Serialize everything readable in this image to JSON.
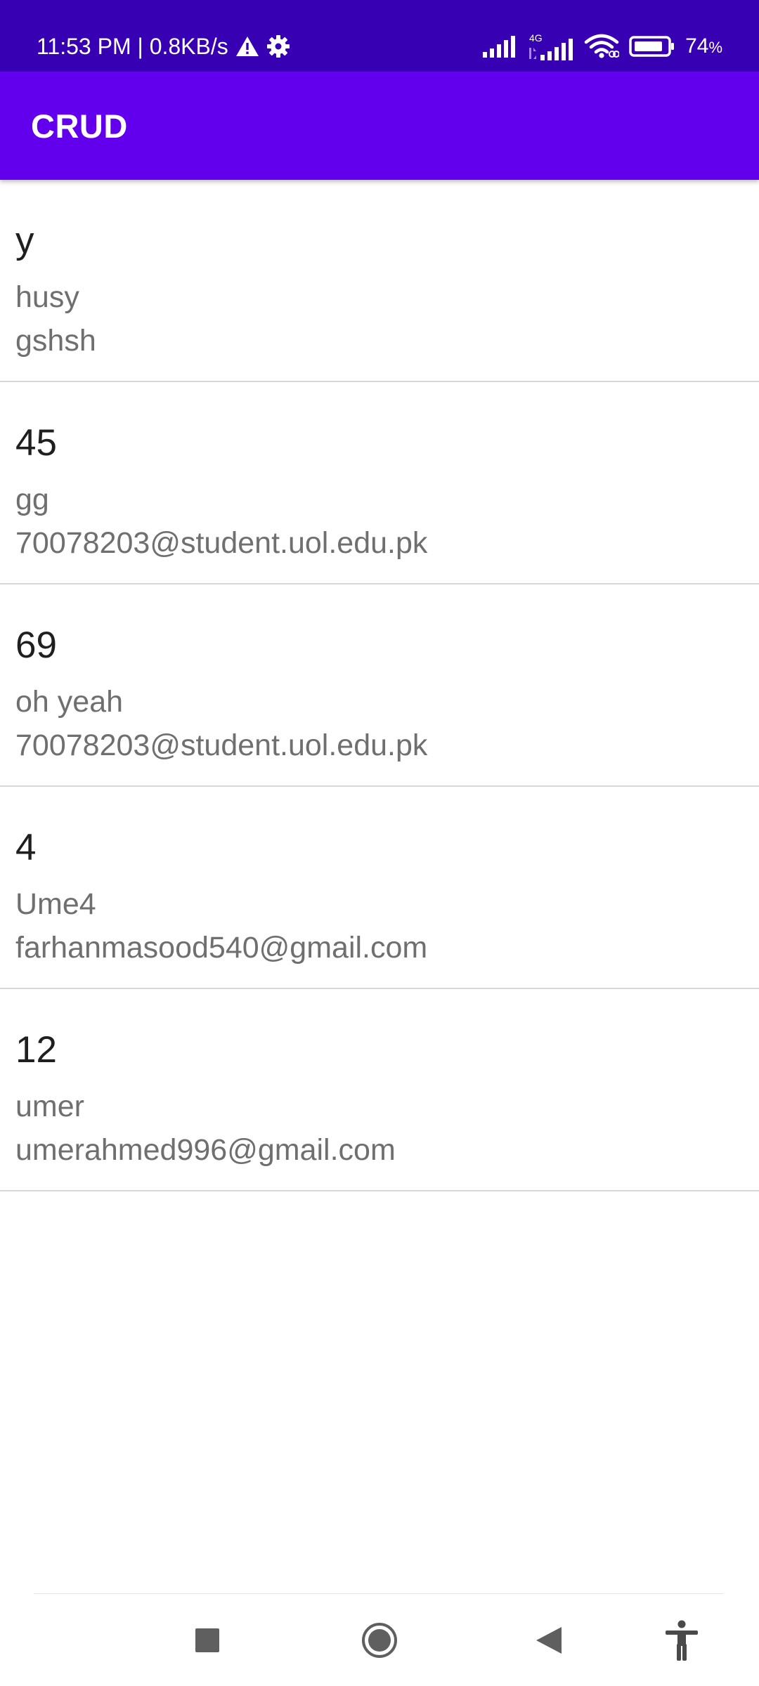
{
  "status_bar": {
    "time_speed": "11:53 PM | 0.8KB/s",
    "network_type": "4G",
    "battery_value": "74",
    "battery_unit": "%",
    "icons": [
      "warning-icon",
      "settings-gear-icon",
      "signal-icon",
      "signal-4g-icon",
      "wifi-icon",
      "battery-icon"
    ]
  },
  "app_bar": {
    "title": "CRUD",
    "color": "#6200ee"
  },
  "list": {
    "items": [
      {
        "title": "y",
        "line1": "husy",
        "line2": "gshsh"
      },
      {
        "title": "45",
        "line1": "gg",
        "line2": "70078203@student.uol.edu.pk"
      },
      {
        "title": "69",
        "line1": "oh yeah",
        "line2": "70078203@student.uol.edu.pk"
      },
      {
        "title": "4",
        "line1": "Ume4",
        "line2": "farhanmasood540@gmail.com"
      },
      {
        "title": "12",
        "line1": "umer",
        "line2": "umerahmed996@gmail.com"
      }
    ]
  },
  "nav_bar": {
    "icons": [
      "recents-square-icon",
      "home-circle-icon",
      "back-triangle-icon",
      "accessibility-icon"
    ]
  }
}
